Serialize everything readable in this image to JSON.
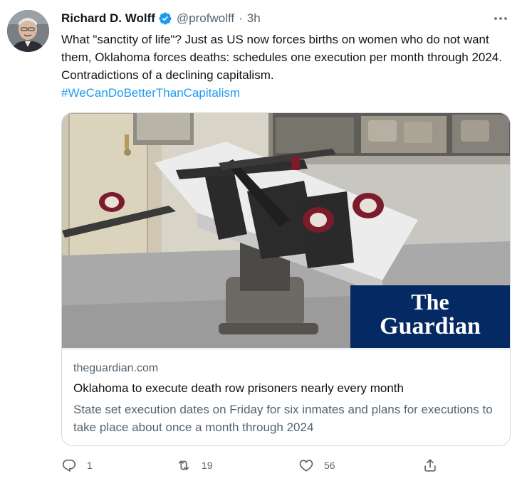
{
  "tweet": {
    "author_name": "Richard D. Wolff",
    "handle": "@profwolff",
    "separator": "·",
    "time": "3h",
    "text": "What \"sanctity of life\"? Just as US now forces births on women who do not want them, Oklahoma forces deaths: schedules one execution per month through 2024. Contradictions of a declining capitalism.",
    "hashtag": "#WeCanDoBetterThanCapitalism"
  },
  "card": {
    "logo_line1": "The",
    "logo_line2": "Guardian",
    "domain": "theguardian.com",
    "title": "Oklahoma to execute death row prisoners nearly every month",
    "description": "State set execution dates on Friday for six inmates and plans for executions to take place about once a month through 2024"
  },
  "actions": {
    "replies": "1",
    "retweets": "19",
    "likes": "56"
  },
  "colors": {
    "accent": "#1d9bf0",
    "guardian_blue": "#052962",
    "secondary_text": "#536471"
  },
  "icons": {
    "verified": "verified-badge-icon",
    "more": "more-horizontal-icon",
    "reply": "reply-icon",
    "retweet": "retweet-icon",
    "like": "heart-icon",
    "share": "share-icon"
  }
}
